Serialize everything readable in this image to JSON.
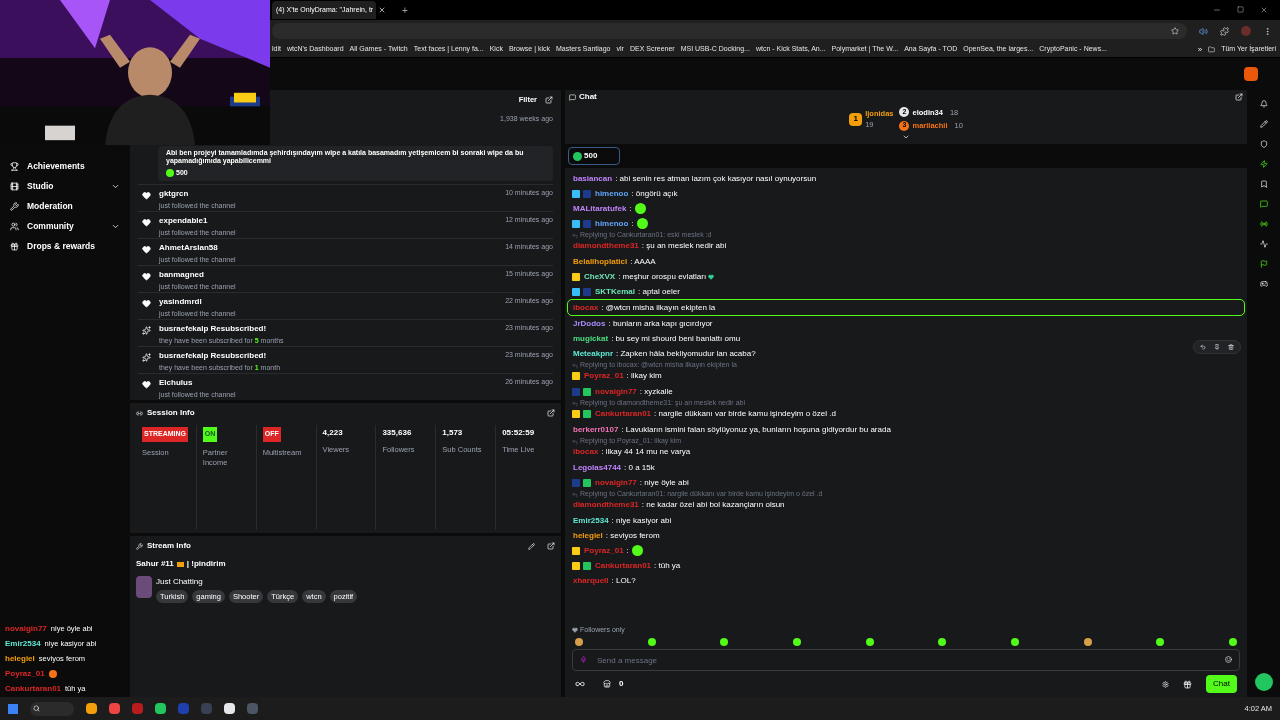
{
  "browser": {
    "tab_title": "(4) X'te OnlyDrama: \"Jahrein, tr",
    "new_tab": "+",
    "bookmarks": [
      "ldit",
      "wtcN's Dashboard",
      "All Games - Twitch",
      "Text faces | Lenny fa...",
      "Kick",
      "Browse | kick",
      "Masters Santiago",
      "vlr",
      "DEX Screener",
      "MSI USB-C Docking...",
      "wtcn - Kick Stats, An...",
      "Polymarket | The W...",
      "Ana Sayfa - TOD",
      "OpenSea, the larges...",
      "CryptoPanic - News..."
    ],
    "more": "»",
    "all_bookmarks": "Tüm Yer İşaretleri"
  },
  "sidebar": {
    "items": [
      {
        "label": "Achievements",
        "expandable": false
      },
      {
        "label": "Studio",
        "expandable": true
      },
      {
        "label": "Moderation",
        "expandable": false
      },
      {
        "label": "Community",
        "expandable": true
      },
      {
        "label": "Drops & rewards",
        "expandable": false
      }
    ]
  },
  "activity": {
    "filter": "Filter",
    "top_time": "1,938 weeks ago",
    "top_message": "Abi ben projeyi tamamladımda şehirdışındayım wipe a katıla basamadım yetişemicem bi sonraki wipe da bu yapamadığımıda yapabilicemmi",
    "top_amount": "500",
    "items": [
      {
        "kind": "follow",
        "name": "gktgrcn",
        "detail": "just followed the channel",
        "time": "10 minutes ago"
      },
      {
        "kind": "follow",
        "name": "expendable1",
        "detail": "just followed the channel",
        "time": "12 minutes ago"
      },
      {
        "kind": "follow",
        "name": "AhmetArslan58",
        "detail": "just followed the channel",
        "time": "14 minutes ago"
      },
      {
        "kind": "follow",
        "name": "banmagned",
        "detail": "just followed the channel",
        "time": "15 minutes ago"
      },
      {
        "kind": "follow",
        "name": "yasindmrdl",
        "detail": "just followed the channel",
        "time": "22 minutes ago"
      },
      {
        "kind": "resub",
        "name": "busraefekalp Resubscribed!",
        "detail": "they have been subscribed for",
        "count": "5",
        "unit": "months",
        "time": "23 minutes ago"
      },
      {
        "kind": "resub",
        "name": "busraefekalp Resubscribed!",
        "detail": "they have been subscribed for",
        "count": "1",
        "unit": "month",
        "time": "23 minutes ago"
      },
      {
        "kind": "follow",
        "name": "Elchulus",
        "detail": "just followed the channel",
        "time": "26 minutes ago"
      }
    ]
  },
  "session": {
    "title": "Session Info",
    "cells": [
      {
        "kind": "status",
        "badge": "STREAMING",
        "color": "#dc2626",
        "label": "Session"
      },
      {
        "kind": "status",
        "badge": "ON",
        "color": "#53fc18",
        "label": "Partner Income"
      },
      {
        "kind": "status",
        "badge": "OFF",
        "color": "#dc2626",
        "label": "Multistream"
      },
      {
        "kind": "stat",
        "value": "4,223",
        "label": "Viewers"
      },
      {
        "kind": "stat",
        "value": "335,636",
        "label": "Followers"
      },
      {
        "kind": "stat",
        "value": "1,573",
        "label": "Sub Counts"
      },
      {
        "kind": "stat",
        "value": "05:52:59",
        "label": "Time Live"
      }
    ]
  },
  "stream_info": {
    "title": "Stream Info",
    "stream_title": "Sahur #11",
    "stream_command": "| !pindirim",
    "category": "Just Chatting",
    "tags": [
      "Turkish",
      "gaming",
      "Shooter",
      "Türkçe",
      "wtcn",
      "pozitif"
    ]
  },
  "chat": {
    "title": "Chat",
    "leaders": [
      {
        "rank": "1",
        "name": "ljonidas",
        "count": "19"
      },
      {
        "rank": "2",
        "name": "elodin34",
        "count": "18"
      },
      {
        "rank": "3",
        "name": "marilachii",
        "count": "10"
      }
    ],
    "pinned_amount": "500",
    "messages": [
      {
        "user": "basiancan",
        "color": "#c084fc",
        "text": ": abi senin res atman lazım çok kasıyor nasıl oynuyorsun",
        "highlighted": false
      },
      {
        "user": "himenoo",
        "color": "#60a5fa",
        "text": ": öngörü açık",
        "badges": [
          {
            "kind": "mod"
          },
          {
            "kind": "og"
          }
        ],
        "highlighted": false
      },
      {
        "user": "MALitaratufek",
        "color": "#c084fc",
        "text": ":",
        "emote": true,
        "highlighted": false
      },
      {
        "user": "himenoo",
        "color": "#60a5fa",
        "text": ":",
        "emote": true,
        "badges": [
          {
            "kind": "mod"
          },
          {
            "kind": "og"
          }
        ],
        "highlighted": false
      },
      {
        "reply": "Replying to Cankurtaran01: eski meslek :d",
        "user": "diamondtheme31",
        "color": "#dc2626",
        "text": ": şu an meslek nedir abi",
        "highlighted": false
      },
      {
        "user": "Belalihoplatici",
        "color": "#f59e0b",
        "text": ": AAAA",
        "highlighted": false
      },
      {
        "user": "CheXVX",
        "color": "#6ee7b7",
        "text": ": meşhur orospu evlatları",
        "heart": true,
        "badges": [
          {
            "kind": "vip"
          }
        ],
        "highlighted": false
      },
      {
        "user": "SKTKemal",
        "color": "#6ee7b7",
        "text": ": aptal oeler",
        "badges": [
          {
            "kind": "mod"
          },
          {
            "kind": "og"
          }
        ],
        "highlighted": false
      },
      {
        "user": "ibocax",
        "color": "#dc2626",
        "text": ": @wtcn misha ilkayın ekipten la",
        "highlighted": true
      },
      {
        "user": "JrDodos",
        "color": "#a78bfa",
        "text": ": bunların arka kapı gıcırdıyor",
        "highlighted": false
      },
      {
        "user": "mugickat",
        "color": "#4ade80",
        "text": ": bu sey mi shourd beni banlattı omu",
        "highlighted": false
      },
      {
        "user": "Meteakpnr",
        "color": "#5eead4",
        "text": ": Zapken hâla bekliyomudur lan acaba?",
        "highlighted": false
      },
      {
        "reply": "Replying to ibocax: @wtcn misha ilkayın ekipten la",
        "user": "Poyraz_01",
        "color": "#dc2626",
        "text": ": ilkay kim",
        "badges": [
          {
            "kind": "vip"
          }
        ],
        "highlighted": false
      },
      {
        "user": "novaigin77",
        "color": "#dc2626",
        "text": ": xyzkalle",
        "badges": [
          {
            "kind": "og"
          },
          {
            "kind": "sub"
          }
        ],
        "highlighted": false
      },
      {
        "reply": "Replying to diamondtheme31: şu an meslek nedir abi",
        "user": "Cankurtaran01",
        "color": "#dc2626",
        "text": ": nargile dükkanı var birde kamu işindeyim o özel .d",
        "badges": [
          {
            "kind": "vip"
          },
          {
            "kind": "sub"
          }
        ],
        "highlighted": false
      },
      {
        "user": "berkerr0107",
        "color": "#f472b6",
        "text": ": Lavukların ismini falan söylüyonuz ya, bunların hoşuna gidiyordur bu arada",
        "highlighted": false
      },
      {
        "reply": "Replying to Poyraz_01: ilkay kim",
        "user": "ibocax",
        "color": "#dc2626",
        "text": ": ilkay 44 14 mu ne varya",
        "highlighted": false
      },
      {
        "user": "Legolas4744",
        "color": "#c084fc",
        "text": ": 0 a 15k",
        "highlighted": false
      },
      {
        "user": "novaigin77",
        "color": "#dc2626",
        "text": ": niye öyle abi",
        "badges": [
          {
            "kind": "og"
          },
          {
            "kind": "sub"
          }
        ],
        "highlighted": false
      },
      {
        "reply": "Replying to Cankurtaran01: nargile dükkanı var birde kamu işindeyim o özel .d",
        "user": "diamondtheme31",
        "color": "#dc2626",
        "text": ": ne kadar özel abi bol kazançların olsun",
        "highlighted": false
      },
      {
        "user": "Emir2534",
        "color": "#5eead4",
        "text": ": niye kasiyor abi",
        "highlighted": false
      },
      {
        "user": "helegiel",
        "color": "#f59e0b",
        "text": ": seviyos ferom",
        "highlighted": false
      },
      {
        "user": "Poyraz_01",
        "color": "#dc2626",
        "text": ":",
        "emote": true,
        "badges": [
          {
            "kind": "vip"
          }
        ],
        "highlighted": false
      },
      {
        "user": "Cankurtaran01",
        "color": "#dc2626",
        "text": ": tüh ya",
        "badges": [
          {
            "kind": "vip"
          },
          {
            "kind": "sub"
          }
        ],
        "highlighted": false
      },
      {
        "user": "xharquell",
        "color": "#dc2626",
        "text": ": LOL?",
        "highlighted": false
      }
    ],
    "followers_only": "Followers only",
    "placeholder": "Send a message",
    "store_count": "0",
    "send": "Chat"
  },
  "overlay_chat": [
    {
      "user": "novaigin77",
      "color": "#dc2626",
      "text": "niye öyle abi"
    },
    {
      "user": "Emir2534",
      "color": "#5eead4",
      "text": "niye kasiyor abi"
    },
    {
      "user": "helegiel",
      "color": "#f59e0b",
      "text": "seviyos ferom"
    },
    {
      "user": "Poyraz_01",
      "color": "#dc2626",
      "emote": true
    },
    {
      "user": "Cankurtaran01",
      "color": "#dc2626",
      "text": "tüh ya"
    }
  ],
  "taskbar": {
    "time": "4:02 AM"
  }
}
